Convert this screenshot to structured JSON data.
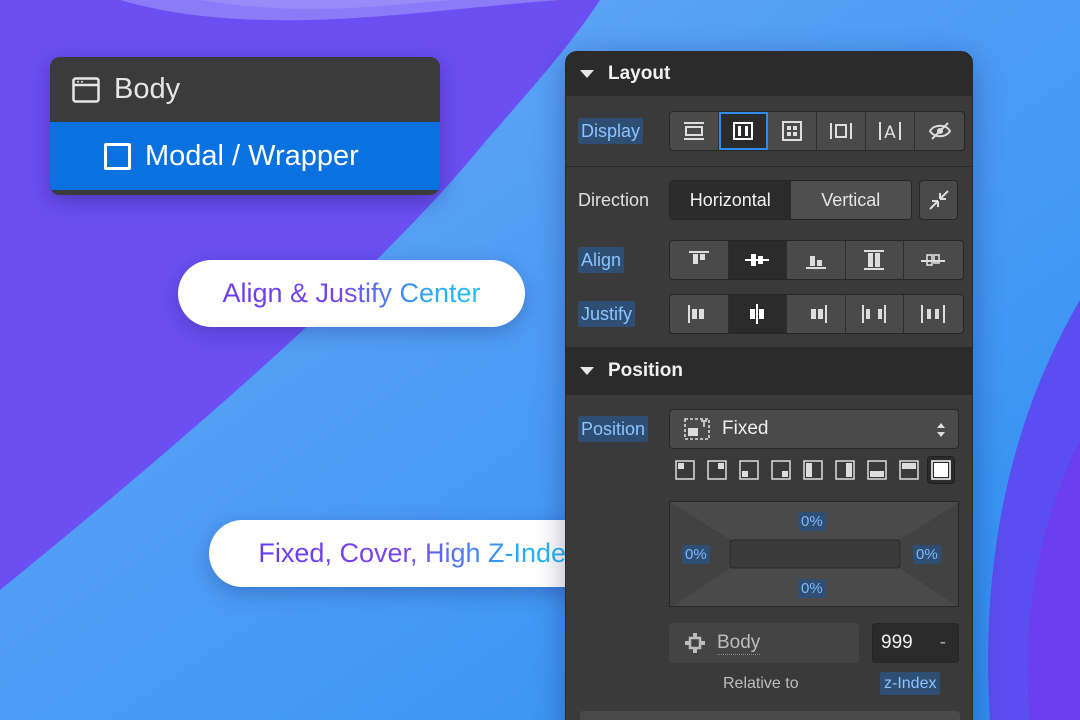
{
  "navigator": {
    "body_label": "Body",
    "selected_label": "Modal / Wrapper"
  },
  "pills": {
    "align_justify": "Align & Justify Center",
    "fixed_cover": "Fixed, Cover, High Z-Index"
  },
  "layout": {
    "section_title": "Layout",
    "display_label": "Display",
    "display_options": [
      "block",
      "flex",
      "grid",
      "inline-block",
      "inline",
      "none"
    ],
    "display_selected": "flex",
    "direction_label": "Direction",
    "direction_horizontal": "Horizontal",
    "direction_vertical": "Vertical",
    "direction_selected": "Horizontal",
    "align_label": "Align",
    "align_selected": "center",
    "justify_label": "Justify",
    "justify_selected": "center"
  },
  "position": {
    "section_title": "Position",
    "position_label": "Position",
    "position_value": "Fixed",
    "preset_selected": "full",
    "offset_top": "0%",
    "offset_left": "0%",
    "offset_right": "0%",
    "offset_bottom": "0%",
    "relative_element": "Body",
    "z_index_value": "999",
    "z_index_unit": "-",
    "relative_to_label": "Relative to",
    "z_index_label": "z-Index"
  },
  "colors": {
    "accent_blue": "#0a72e0",
    "panel_bg": "#3a3a3a",
    "highlight_label": "#8cc4ff"
  }
}
